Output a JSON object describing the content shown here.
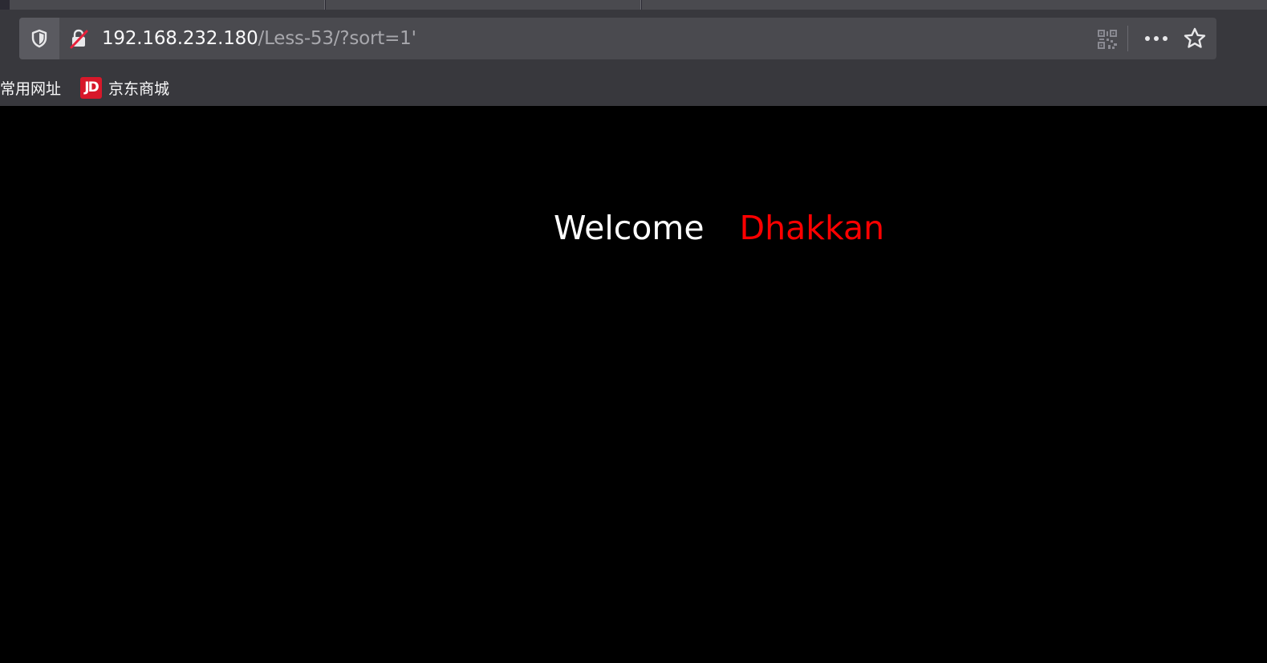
{
  "browser": {
    "url_host": "192.168.232.180",
    "url_path": "/Less-53/?sort=1'"
  },
  "icons": {
    "tracking": "shield-icon",
    "connection": "insecure-lock-icon",
    "qr": "qr-code-icon",
    "menu": "more-icon",
    "bookmark": "star-icon",
    "jd_favicon_text": "JD"
  },
  "bookmarks": [
    {
      "label": "常用网址"
    },
    {
      "label": "京东商城"
    }
  ],
  "page": {
    "greeting": "Welcome",
    "name": "Dhakkan"
  },
  "colors": {
    "page_background": "#000000",
    "greeting_color": "#ffffff",
    "name_color": "#ff0000",
    "jd_brand": "#d7182a"
  }
}
